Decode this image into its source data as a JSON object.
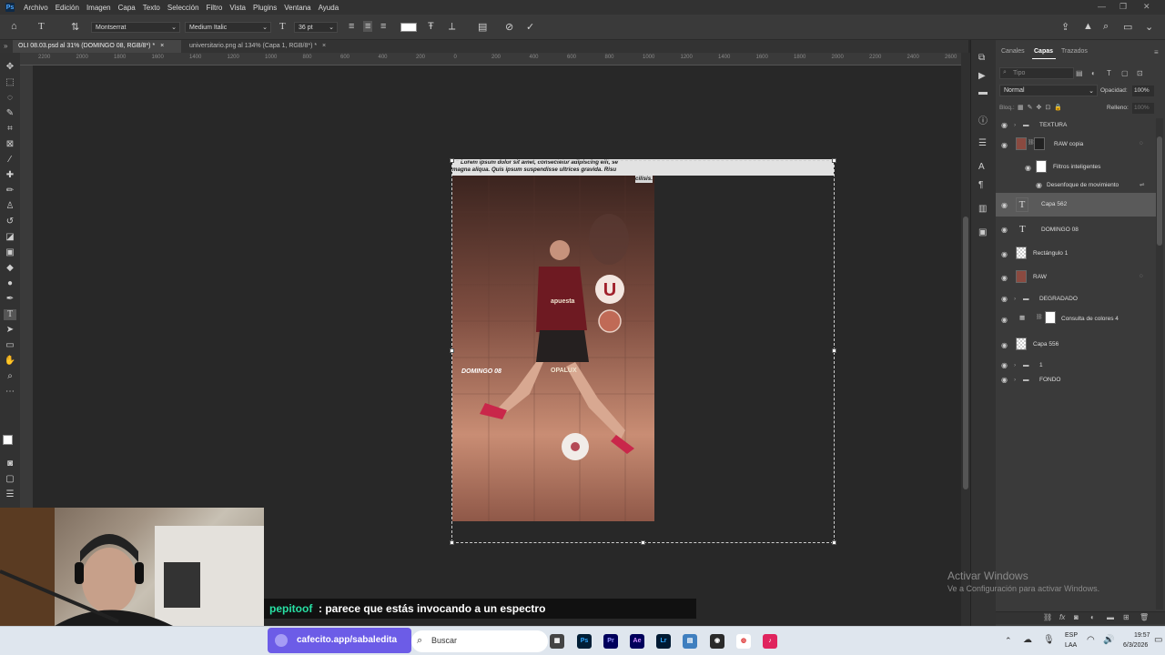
{
  "menu": [
    "Archivo",
    "Edición",
    "Imagen",
    "Capa",
    "Texto",
    "Selección",
    "Filtro",
    "Vista",
    "Plugins",
    "Ventana",
    "Ayuda"
  ],
  "options": {
    "font_family": "Montserrat",
    "font_style": "Medium Italic",
    "font_size": "36 pt"
  },
  "tabs": [
    {
      "label": "OLI 08.03.psd al 31% (DOMINGO 08, RGB/8*) *",
      "close": "×"
    },
    {
      "label": "universitario.png al 134% (Capa 1, RGB/8*) *",
      "close": "×"
    }
  ],
  "ruler_ticks": [
    "2200",
    "2000",
    "1800",
    "1600",
    "1400",
    "1200",
    "1000",
    "800",
    "600",
    "400",
    "200",
    "0",
    "200",
    "400",
    "600",
    "800",
    "1000",
    "1200",
    "1400",
    "1600",
    "1800",
    "2000",
    "2200",
    "2400",
    "2600"
  ],
  "canvas": {
    "lorem_lines": [
      "Lorem ipsum dolor sit amet, consectetur adipiscing elit, se",
      "magna aliqua. Quis ipsum suspendisse ultrices gravida. Risu",
      "cilisis."
    ],
    "domingo_label": "DOMINGO 08"
  },
  "panel": {
    "tabs": [
      "Canales",
      "Capas",
      "Trazados"
    ],
    "search_placeholder": "Tipo",
    "blend_mode": "Normal",
    "opacity_label": "Opacidad:",
    "opacity_value": "100%",
    "lock_label": "Bloq.:",
    "fill_label": "Relleno:",
    "fill_value": "100%",
    "layers": [
      {
        "name": "TEXTURA",
        "type": "group"
      },
      {
        "name": "RAW copia",
        "type": "smart"
      },
      {
        "name": "Filtros inteligentes",
        "type": "sub"
      },
      {
        "name": "Desenfoque de movimiento",
        "type": "subfilter"
      },
      {
        "name": "Capa 562",
        "type": "text",
        "selected": true
      },
      {
        "name": "DOMINGO 08",
        "type": "text"
      },
      {
        "name": "Rectángulo 1",
        "type": "pixel"
      },
      {
        "name": "RAW",
        "type": "smart"
      },
      {
        "name": "DEGRADADO",
        "type": "group"
      },
      {
        "name": "Consulta de colores 4",
        "type": "adjust"
      },
      {
        "name": "Capa 556",
        "type": "pixel"
      },
      {
        "name": "1",
        "type": "group"
      },
      {
        "name": "FONDO",
        "type": "group"
      }
    ]
  },
  "watermark": {
    "title": "Activar Windows",
    "subtitle": "Ve a Configuración para activar Windows."
  },
  "chat": {
    "user": "pepitoof",
    "message": ": parece que estás invocando a un espectro"
  },
  "cafecito": "cafecito.app/sabaledita",
  "taskbar": {
    "search": "Buscar",
    "lang_top": "ESP",
    "lang_bottom": "LAA",
    "time": "19:57",
    "date": "6/3/2026",
    "apps": [
      "Ps",
      "Pr",
      "Ae",
      "Lr"
    ]
  },
  "colors": {
    "accent": "#6c5ce7",
    "ps_blue": "#31a8ff"
  }
}
